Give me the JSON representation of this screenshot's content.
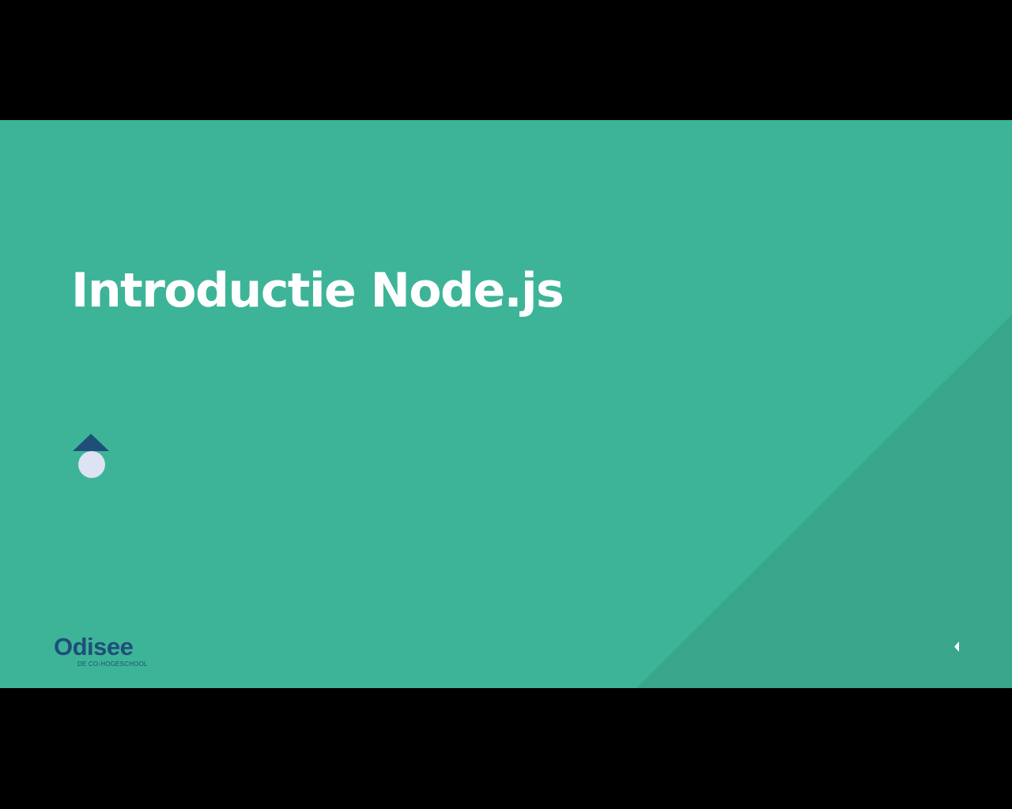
{
  "slide": {
    "title": "Introductie Node.js",
    "background_color": "#3db497",
    "triangle_color": "#38a68b",
    "mark_colors": {
      "triangle": "#1f4e79",
      "circle": "#dde3f2"
    }
  },
  "logo": {
    "word": "Odisee",
    "tagline": "DE CO-HOGESCHOOL",
    "color": "#1f4e79"
  },
  "navigation": {
    "prev_icon": "caret-left-icon",
    "icon_color": "#ffffff"
  },
  "letterbox_color": "#000000"
}
